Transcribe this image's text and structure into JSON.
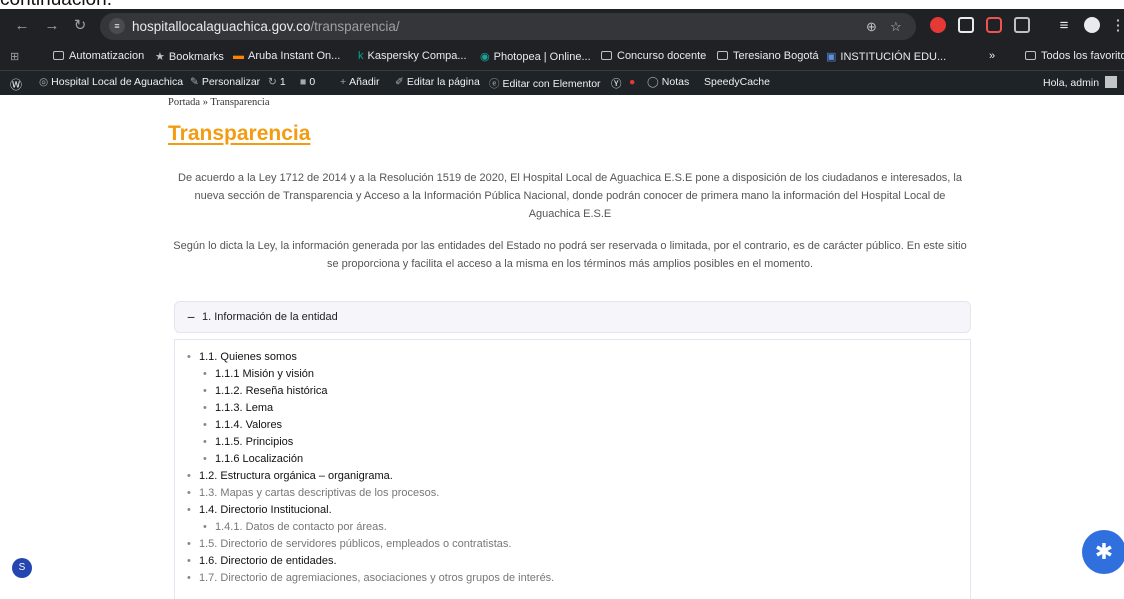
{
  "top_caption": "continuación:",
  "browser": {
    "url_host": "hospitallocalaguachica.gov.co",
    "url_path": "/transparencia/",
    "bookmarks": [
      {
        "label": "Automatizacion"
      },
      {
        "label": "Bookmarks"
      },
      {
        "label": "Aruba Instant On..."
      },
      {
        "label": "Kaspersky Compa..."
      },
      {
        "label": "Photopea | Online..."
      },
      {
        "label": "Concurso docente"
      },
      {
        "label": "Teresiano Bogotá"
      },
      {
        "label": "INSTITUCIÓN EDU..."
      },
      {
        "label": "»"
      },
      {
        "label": "Todos los favoritos"
      }
    ]
  },
  "wp_admin_bar": {
    "site_name": "Hospital Local de Aguachica",
    "customize": "Personalizar",
    "updates_count": "1",
    "comments_count": "0",
    "add_new": "Añadir",
    "edit_page": "Editar la página",
    "edit_elementor": "Editar con Elementor",
    "notes": "Notas",
    "speedycache": "SpeedyCache",
    "greeting": "Hola, admin"
  },
  "page": {
    "breadcrumb": "Portada » Transparencia",
    "title": "Transparencia",
    "intro_paragraph_1": "De acuerdo a la Ley 1712 de 2014 y a la Resolución 1519 de 2020, El Hospital Local de Aguachica E.S.E pone a disposición de los ciudadanos e interesados, la nueva sección de Transparencia y Acceso a la Información Pública Nacional, donde podrán conocer de primera mano la información del Hospital Local de Aguachica E.S.E",
    "intro_paragraph_2": "Según lo dicta la Ley, la información generada por las entidades del Estado no podrá ser reservada o limitada, por el contrario, es de carácter público. En este sitio se proporciona y facilita el acceso a la misma en los términos más amplios posibles en el momento.",
    "accordion": {
      "toggle": "−",
      "title": "1. Información de la entidad",
      "items": [
        {
          "label": "1.1. Quienes somos"
        },
        {
          "label": "1.1.1 Misión y visión"
        },
        {
          "label": "1.1.2. Reseña histórica"
        },
        {
          "label": "1.1.3. Lema"
        },
        {
          "label": "1.1.4. Valores"
        },
        {
          "label": "1.1.5. Principios"
        },
        {
          "label": "1.1.6 Localización"
        },
        {
          "label": "1.2. Estructura orgánica – organigrama."
        },
        {
          "label": "1.3. Mapas y cartas descriptivas de los procesos."
        },
        {
          "label": "1.4. Directorio Institucional."
        },
        {
          "label": "1.4.1. Datos de contacto por áreas."
        },
        {
          "label": "1.5. Directorio de servidores públicos, empleados o contratistas."
        },
        {
          "label": "1.6. Directorio de entidades."
        },
        {
          "label": "1.7. Directorio de agremiaciones, asociaciones y otros grupos de interés."
        }
      ]
    }
  }
}
